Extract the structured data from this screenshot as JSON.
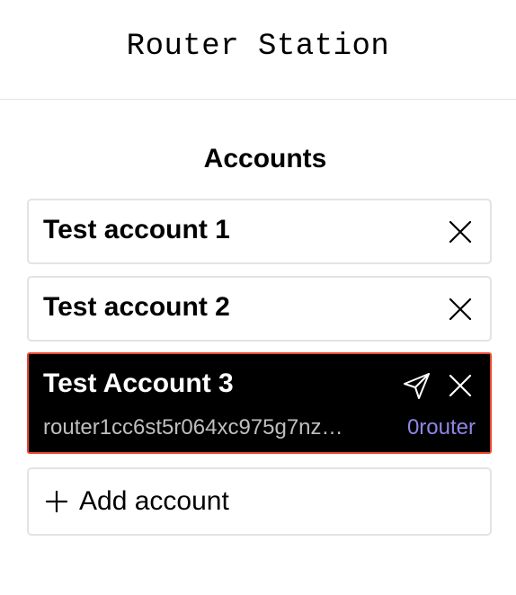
{
  "header": {
    "title": "Router Station"
  },
  "accounts_section": {
    "title": "Accounts",
    "items": [
      {
        "name": "Test account 1",
        "selected": false
      },
      {
        "name": "Test account 2",
        "selected": false
      },
      {
        "name": "Test Account 3",
        "selected": true,
        "address": "router1cc6st5r064xc975g7nz…",
        "balance": "0router"
      }
    ],
    "add_label": "Add account"
  },
  "icons": {
    "close": "close-icon",
    "send": "send-icon",
    "add": "plus-icon"
  },
  "colors": {
    "selected_background": "#000000",
    "selected_border": "#e8492d",
    "balance_text": "#8f86e6",
    "address_text": "#bfbfbf",
    "card_border": "#e3e3e3"
  }
}
